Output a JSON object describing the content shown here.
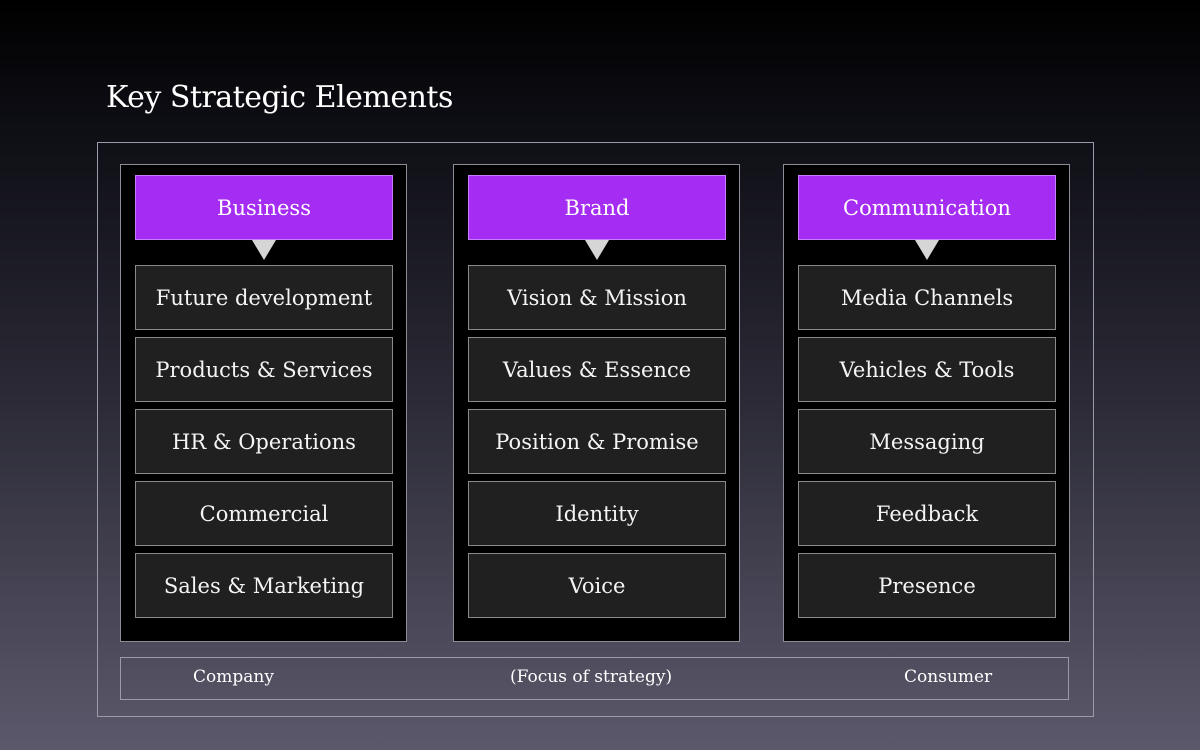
{
  "title": "Key Strategic Elements",
  "columns": [
    {
      "header": "Business",
      "items": [
        "Future development",
        "Products & Services",
        "HR & Operations",
        "Commercial",
        "Sales & Marketing"
      ]
    },
    {
      "header": "Brand",
      "items": [
        "Vision & Mission",
        "Values & Essence",
        "Position & Promise",
        "Identity",
        "Voice"
      ]
    },
    {
      "header": "Communication",
      "items": [
        "Media Channels",
        "Vehicles & Tools",
        "Messaging",
        "Feedback",
        "Presence"
      ]
    }
  ],
  "axis": {
    "left": "Company",
    "center": "(Focus of strategy)",
    "right": "Consumer"
  },
  "colors": {
    "header_fill": "#a52cf2",
    "pointer": "#d6d6d6",
    "item_fill": "#202020"
  },
  "icons": {
    "pointer": "down-triangle-icon"
  }
}
